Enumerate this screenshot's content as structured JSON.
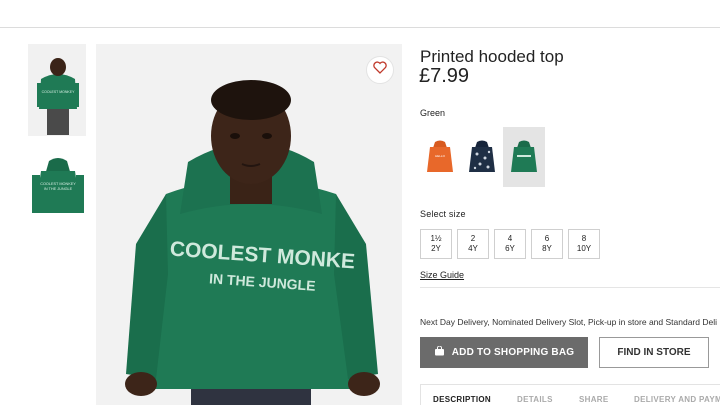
{
  "product": {
    "title": "Printed hooded top",
    "price": "£7.99"
  },
  "color": {
    "selected_label": "Green",
    "swatches": [
      {
        "name": "orange",
        "color": "#e8682a"
      },
      {
        "name": "navy print",
        "color": "#1f2f45"
      },
      {
        "name": "green",
        "color": "#1f7a55"
      }
    ]
  },
  "sizes": {
    "label": "Select size",
    "options": [
      {
        "a": "1½",
        "b": "2Y"
      },
      {
        "a": "2",
        "b": "4Y"
      },
      {
        "a": "4",
        "b": "6Y"
      },
      {
        "a": "6",
        "b": "8Y"
      },
      {
        "a": "8",
        "b": "10Y"
      }
    ],
    "guide": "Size Guide"
  },
  "delivery_text": "Next Day Delivery, Nominated Delivery Slot, Pick-up in store and Standard Deli",
  "buttons": {
    "add_to_bag": "ADD TO SHOPPING BAG",
    "find_in_store": "FIND IN STORE"
  },
  "tabs": [
    "DESCRIPTION",
    "DETAILS",
    "SHARE",
    "DELIVERY AND PAYM"
  ],
  "image_print": {
    "line1": "COOLEST MONKE",
    "line2": "IN THE JUNGLE"
  },
  "thumb_print": "COOLEST MONKEY IN THE JUNGLE",
  "theme": {
    "hoodie_green": "#1f7a55",
    "button_gray": "#6b6b6b"
  }
}
